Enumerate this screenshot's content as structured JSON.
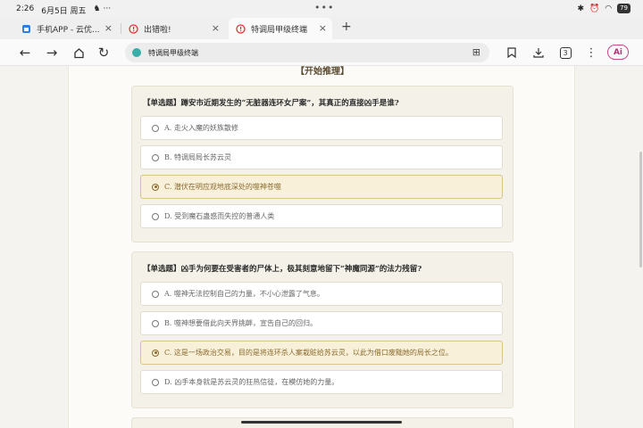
{
  "status": {
    "time": "2:26",
    "date": "6月5日 周五",
    "center_dots": "•••",
    "battery": "79"
  },
  "tabs": [
    {
      "label": "手机APP - 云优...",
      "close": "×"
    },
    {
      "label": "出错啦!",
      "close": "×"
    },
    {
      "label": "特调局甲级终端",
      "close": "×"
    }
  ],
  "new_tab": "+",
  "toolbar": {
    "url": "特调局甲级终端",
    "tab_count": "3",
    "ai_label": "Ai"
  },
  "page": {
    "header": "【开始推理】",
    "questions": [
      {
        "title": "【单选题】蹲安市近期发生的“无脏器连环女尸案”，其真正的直接凶手是谁?",
        "options": [
          {
            "text": "A. 走火入魔的妖族散修",
            "selected": false
          },
          {
            "text": "B. 特调局局长苏云灵",
            "selected": false
          },
          {
            "text": "C. 潜伏在明应观地底深处的噬神苍噬",
            "selected": true
          },
          {
            "text": "D. 受到魔石蛊惑而失控的普通人类",
            "selected": false
          }
        ]
      },
      {
        "title": "【单选题】凶手为何要在受害者的尸体上，极其刻意地留下“神魔同源”的法力残留?",
        "options": [
          {
            "text": "A. 噬神无法控制自己的力量，不小心泄露了气息。",
            "selected": false
          },
          {
            "text": "B. 噬神想要借此向天界挑衅，宣告自己的回归。",
            "selected": false
          },
          {
            "text": "C. 这是一场政治交易，目的是将连环杀人案栽赃给苏云灵，以此为借口废黜她的局长之位。",
            "selected": true
          },
          {
            "text": "D. 凶手本身就是苏云灵的狂热信徒，在模仿她的力量。",
            "selected": false
          }
        ]
      }
    ]
  }
}
